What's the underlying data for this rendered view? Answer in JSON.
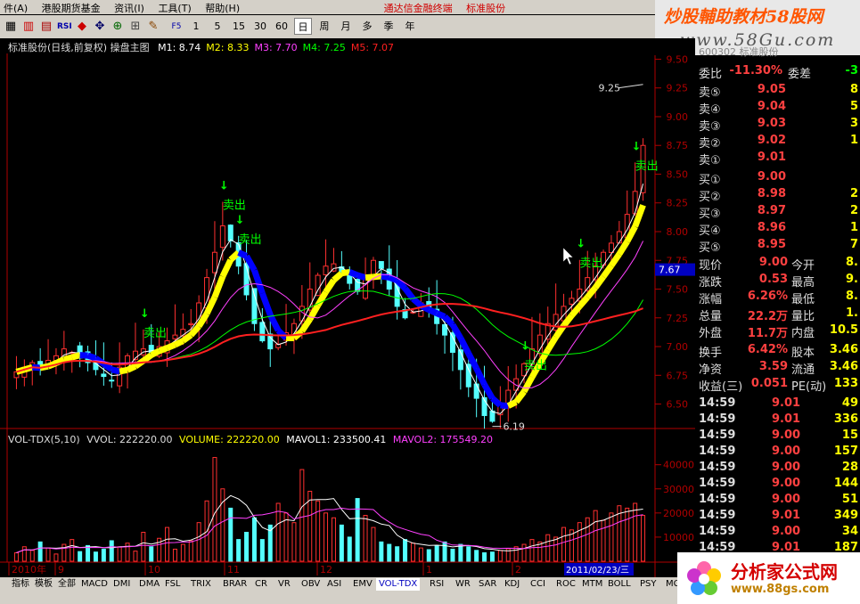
{
  "menu": {
    "items": [
      "件(A)",
      "港股期货基金",
      "资讯(I)",
      "工具(T)",
      "帮助(H)"
    ],
    "center_text": "通达信金融终端",
    "stock_name": "标准股份"
  },
  "toolbar": {
    "periods": [
      "1",
      "5",
      "15",
      "30",
      "60",
      "日",
      "周",
      "月",
      "多",
      "季",
      "年"
    ],
    "active_period": "日"
  },
  "brand": {
    "line1": "炒股輔助教材58股网",
    "line2": "www.58Gu.com"
  },
  "chart_title": {
    "name": "标准股份(日线,前复权) 操盘主图",
    "ma": [
      {
        "label": "M1: 8.74",
        "color": "#ffffff"
      },
      {
        "label": "M2: 8.33",
        "color": "#ffff00"
      },
      {
        "label": "M3: 7.70",
        "color": "#ff40ff"
      },
      {
        "label": "M4: 7.25",
        "color": "#00ff00"
      },
      {
        "label": "M5: 7.07",
        "color": "#ff2020"
      }
    ]
  },
  "vol_title": {
    "name": "VOL-TDX(5,10)",
    "vvol": "VVOL: 222220.00",
    "volume": "VOLUME: 222220.00",
    "mavol1": "MAVOL1: 233500.41",
    "mavol2": "MAVOL2: 175549.20"
  },
  "chart_data": [
    {
      "type": "candlestick",
      "title": "标准股份(日线,前复权) 操盘主图",
      "y_ticks": [
        "9.50",
        "9.25",
        "9.00",
        "8.75",
        "8.50",
        "8.25",
        "8.00",
        "7.75",
        "7.50",
        "7.25",
        "7.00",
        "6.75",
        "6.50"
      ],
      "ylim": [
        6.45,
        9.55
      ],
      "current_price_tag": "7.67",
      "annotations": {
        "high": "9.25",
        "low": "6.19",
        "sell": "卖出"
      },
      "close_path": [
        6.78,
        6.82,
        6.86,
        6.8,
        6.88,
        6.92,
        6.98,
        6.95,
        6.9,
        6.86,
        6.8,
        6.74,
        6.7,
        6.82,
        6.92,
        6.96,
        6.98,
        6.95,
        7.0,
        7.05,
        7.1,
        7.15,
        7.2,
        7.38,
        7.6,
        7.82,
        8.05,
        7.92,
        7.7,
        7.45,
        7.2,
        7.05,
        6.98,
        7.02,
        7.12,
        7.2,
        7.35,
        7.5,
        7.62,
        7.7,
        7.72,
        7.65,
        7.55,
        7.48,
        7.6,
        7.75,
        7.68,
        7.5,
        7.35,
        7.25,
        7.3,
        7.38,
        7.32,
        7.2,
        7.1,
        6.95,
        6.8,
        6.65,
        6.55,
        6.4,
        6.35,
        6.5,
        6.62,
        6.72,
        6.85,
        6.98,
        7.1,
        7.2,
        7.28,
        7.35,
        7.42,
        7.5,
        7.6,
        7.7,
        7.82,
        7.9,
        8.0,
        8.15,
        8.35,
        8.75
      ],
      "series": [
        {
          "name": "M1",
          "color": "#ffffff"
        },
        {
          "name": "M2",
          "color": "#ffff00"
        },
        {
          "name": "M3",
          "color": "#ff40ff"
        },
        {
          "name": "M4",
          "color": "#00ff00"
        },
        {
          "name": "M5",
          "color": "#ff2020"
        }
      ]
    },
    {
      "type": "bar",
      "title": "VOL-TDX(5,10)",
      "y_ticks": [
        "40000",
        "30000",
        "20000",
        "10000"
      ],
      "ylim": [
        0,
        48000
      ],
      "volume": [
        3500,
        6000,
        4500,
        8000,
        5500,
        3000,
        7000,
        9000,
        4000,
        6500,
        3800,
        5000,
        8500,
        6000,
        7500,
        4200,
        12000,
        6000,
        9500,
        14000,
        5000,
        7000,
        8500,
        16000,
        25000,
        43000,
        30000,
        22000,
        9000,
        12000,
        18000,
        9000,
        15000,
        24000,
        20000,
        16000,
        38000,
        29000,
        25000,
        20000,
        18000,
        15000,
        10000,
        26000,
        19000,
        14000,
        8000,
        7000,
        6000,
        9000,
        7500,
        5500,
        4800,
        6500,
        8000,
        5000,
        7000,
        6000,
        4500,
        3500,
        3800,
        4500,
        5200,
        6000,
        7000,
        9000,
        8000,
        11000,
        10000,
        14000,
        13000,
        16000,
        18000,
        21000,
        17000,
        20000,
        23000,
        22000,
        24000,
        19000
      ]
    }
  ],
  "date_axis": {
    "labels": [
      "2010年",
      "9",
      "10",
      "11",
      "12",
      "1",
      "2"
    ],
    "current_date": "2011/02/23/三"
  },
  "quote": {
    "title": "标准股份",
    "code": "600302",
    "weibi": {
      "label": "委比",
      "value": "-11.30%",
      "label2": "委差",
      "value2": "-3"
    },
    "asks": [
      {
        "label": "卖⑤",
        "price": "9.05",
        "vol": "8"
      },
      {
        "label": "卖④",
        "price": "9.04",
        "vol": "5"
      },
      {
        "label": "卖③",
        "price": "9.03",
        "vol": "3"
      },
      {
        "label": "卖②",
        "price": "9.02",
        "vol": "1"
      },
      {
        "label": "卖①",
        "price": "9.01",
        "vol": ""
      }
    ],
    "bids": [
      {
        "label": "买①",
        "price": "9.00",
        "vol": ""
      },
      {
        "label": "买②",
        "price": "8.98",
        "vol": "2"
      },
      {
        "label": "买③",
        "price": "8.97",
        "vol": "2"
      },
      {
        "label": "买④",
        "price": "8.96",
        "vol": "1"
      },
      {
        "label": "买⑤",
        "price": "8.95",
        "vol": "7"
      }
    ],
    "stats": [
      {
        "l": "现价",
        "v": "9.00",
        "l2": "今开",
        "v2": "8."
      },
      {
        "l": "涨跌",
        "v": "0.53",
        "l2": "最高",
        "v2": "9."
      },
      {
        "l": "涨幅",
        "v": "6.26%",
        "l2": "最低",
        "v2": "8."
      },
      {
        "l": "总量",
        "v": "22.2万",
        "l2": "量比",
        "v2": "1."
      },
      {
        "l": "外盘",
        "v": "11.7万",
        "l2": "内盘",
        "v2": "10.5"
      },
      {
        "l": "换手",
        "v": "6.42%",
        "l2": "股本",
        "v2": "3.46"
      },
      {
        "l": "净资",
        "v": "3.59",
        "l2": "流通",
        "v2": "3.46"
      },
      {
        "l": "收益(三)",
        "v": "0.051",
        "l2": "PE(动)",
        "v2": "133"
      }
    ],
    "ticks": [
      {
        "t": "14:59",
        "p": "9.01",
        "v": "49"
      },
      {
        "t": "14:59",
        "p": "9.01",
        "v": "336"
      },
      {
        "t": "14:59",
        "p": "9.00",
        "v": "15"
      },
      {
        "t": "14:59",
        "p": "9.00",
        "v": "157"
      },
      {
        "t": "14:59",
        "p": "9.00",
        "v": "28"
      },
      {
        "t": "14:59",
        "p": "9.00",
        "v": "144"
      },
      {
        "t": "14:59",
        "p": "9.00",
        "v": "51"
      },
      {
        "t": "14:59",
        "p": "9.01",
        "v": "349"
      },
      {
        "t": "14:59",
        "p": "9.00",
        "v": "34"
      },
      {
        "t": "14:59",
        "p": "9.01",
        "v": "187"
      }
    ]
  },
  "bottom_tabs": [
    "指标",
    "模板",
    "全部",
    "MACD",
    "DMI",
    "DMA",
    "FSL",
    "TRIX",
    "BRAR",
    "CR",
    "VR",
    "OBV",
    "ASI",
    "EMV",
    "VOL-TDX",
    "RSI",
    "WR",
    "SAR",
    "KDJ",
    "CCI",
    "ROC",
    "MTM",
    "BOLL",
    "PSY",
    "MCST"
  ],
  "active_tab": "VOL-TDX",
  "logo": {
    "name": "分析家公式网",
    "url": "www.88gs.com"
  }
}
